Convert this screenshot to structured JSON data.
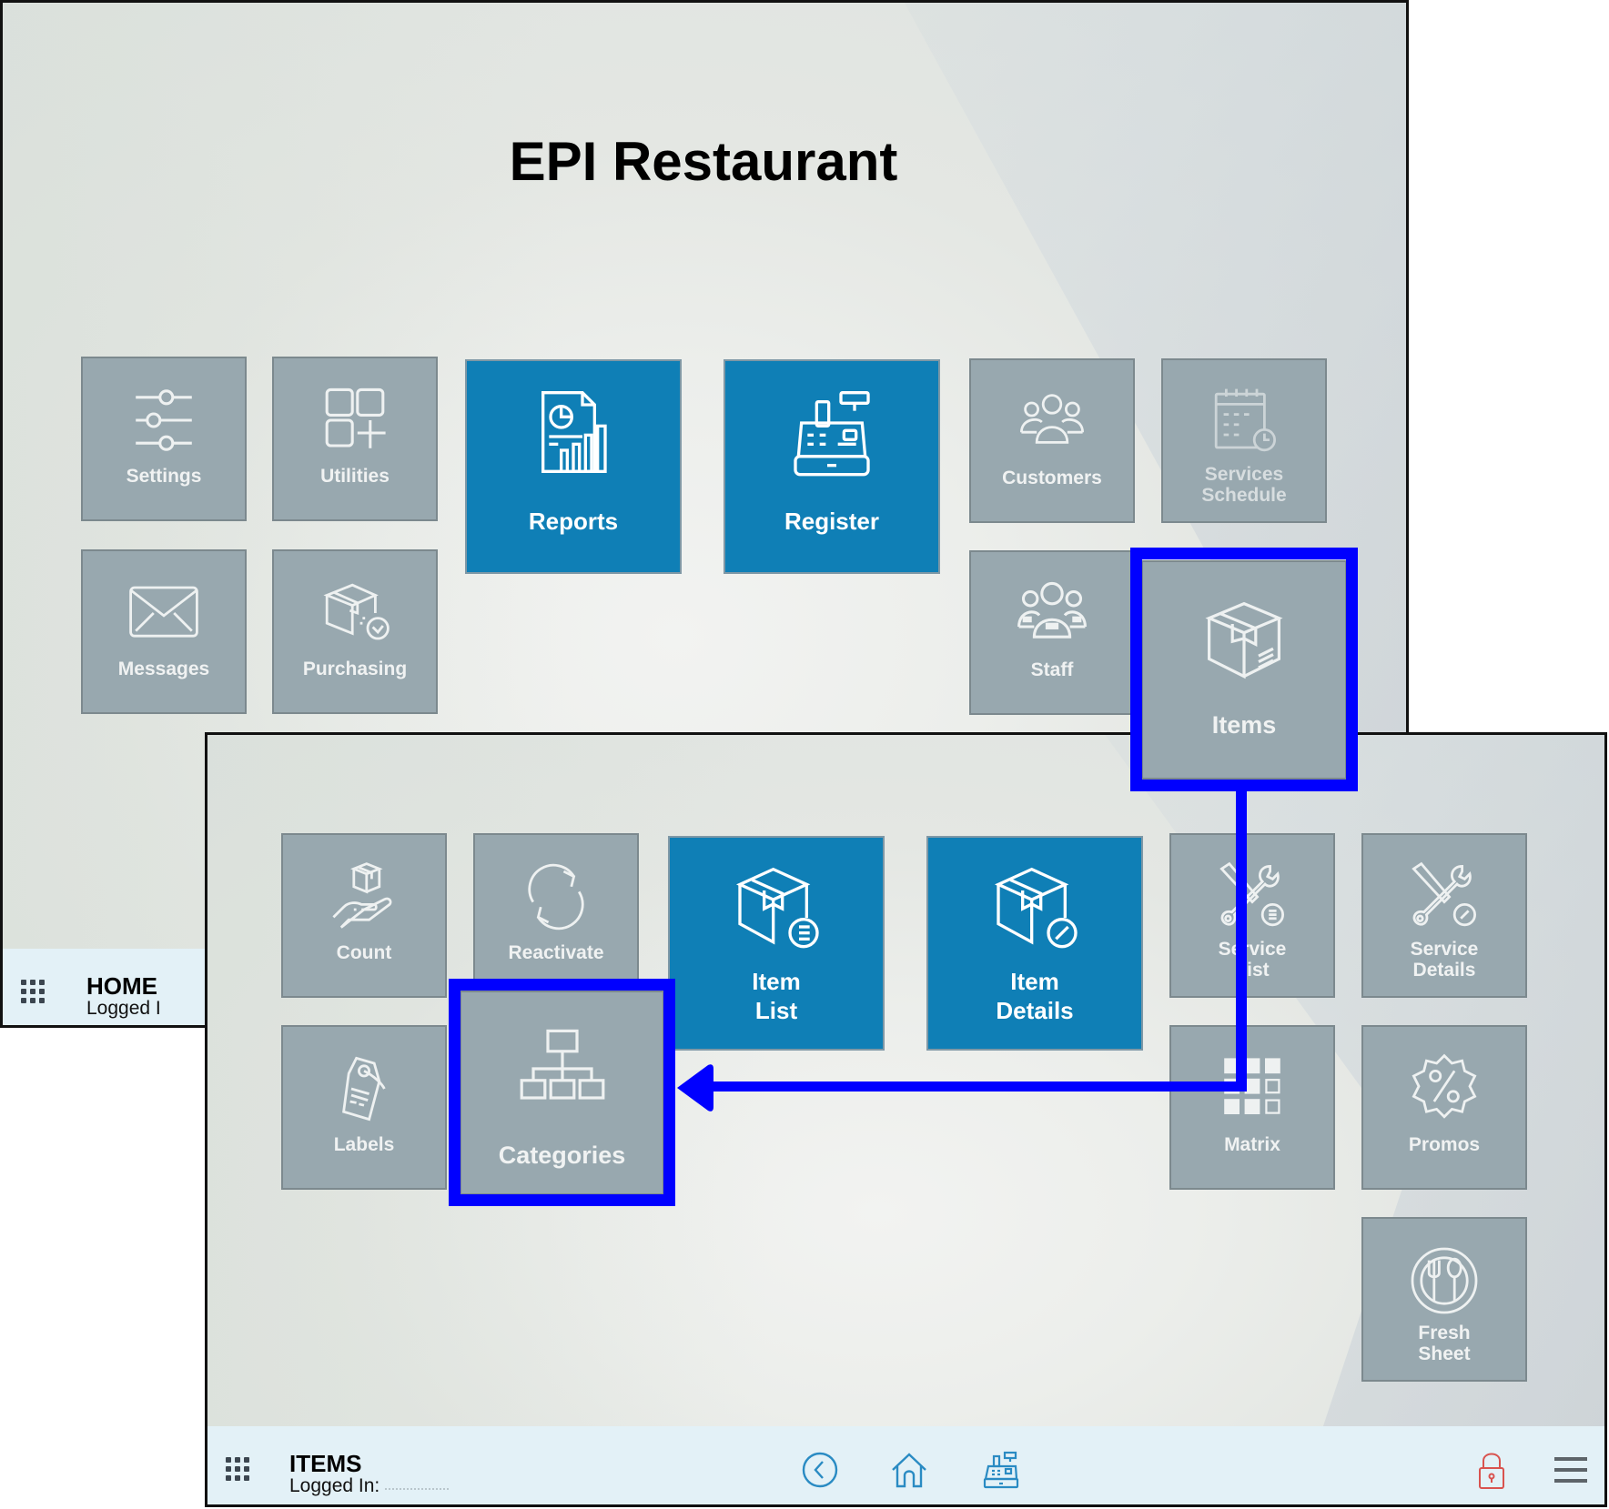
{
  "home": {
    "title": "EPI Restaurant",
    "tiles": [
      {
        "label": "Settings",
        "icon": "sliders-icon"
      },
      {
        "label": "Utilities",
        "icon": "apps-add-icon"
      },
      {
        "label": "Reports",
        "icon": "report-chart-icon"
      },
      {
        "label": "Register",
        "icon": "cash-register-icon"
      },
      {
        "label": "Customers",
        "icon": "customers-group-icon"
      },
      {
        "label": "Services\nSchedule",
        "icon": "calendar-clock-icon"
      },
      {
        "label": "Messages",
        "icon": "envelope-icon"
      },
      {
        "label": "Purchasing",
        "icon": "box-check-icon"
      },
      {
        "label": "Staff",
        "icon": "staff-group-icon"
      },
      {
        "label": "Items",
        "icon": "box-icon"
      }
    ],
    "bottom_bar": {
      "screen_name": "HOME",
      "logged_in_label": "Logged I"
    }
  },
  "items": {
    "tiles": [
      {
        "label": "Count",
        "icon": "hand-box-icon"
      },
      {
        "label": "Reactivate",
        "icon": "refresh-icon"
      },
      {
        "label": "Item\nList",
        "icon": "box-list-icon"
      },
      {
        "label": "Item\nDetails",
        "icon": "box-edit-icon"
      },
      {
        "label": "Service\nList",
        "icon": "tools-list-icon"
      },
      {
        "label": "Service\nDetails",
        "icon": "tools-edit-icon"
      },
      {
        "label": "Labels",
        "icon": "tag-icon"
      },
      {
        "label": "Categories",
        "icon": "hierarchy-icon"
      },
      {
        "label": "Matrix",
        "icon": "grid-matrix-icon"
      },
      {
        "label": "Promos",
        "icon": "percent-badge-icon"
      },
      {
        "label": "Fresh\nSheet",
        "icon": "plate-cutlery-icon"
      }
    ],
    "bottom_bar": {
      "screen_name": "ITEMS",
      "logged_in_label": "Logged In:",
      "nav_icons": [
        "back-icon",
        "home-icon",
        "register-icon"
      ],
      "right_icons": [
        "lock-icon",
        "menu-icon"
      ]
    }
  },
  "annotation": {
    "highlight_color": "#0000ff",
    "from": "Items",
    "to": "Categories"
  },
  "colors": {
    "tile_gray": "#98a8af",
    "tile_blue": "#0f7fb6",
    "bar_bg": "#e3f1f7",
    "nav_icon": "#2a8bc3",
    "lock_icon": "#d9534f"
  }
}
